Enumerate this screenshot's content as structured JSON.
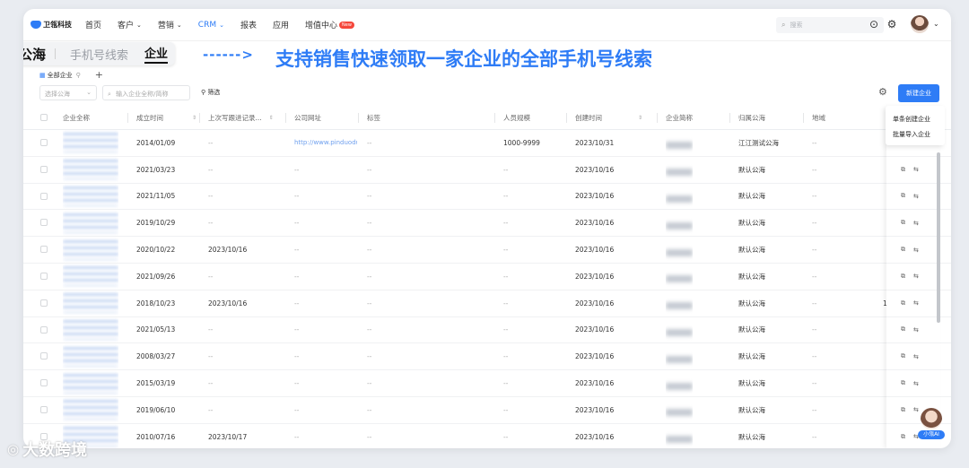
{
  "nav": {
    "logo_text": "卫瓴科技",
    "items": [
      {
        "label": "首页",
        "chevron": false
      },
      {
        "label": "客户",
        "chevron": true
      },
      {
        "label": "营销",
        "chevron": true
      },
      {
        "label": "CRM",
        "chevron": true,
        "active": true
      },
      {
        "label": "报表",
        "chevron": false
      },
      {
        "label": "应用",
        "chevron": false
      },
      {
        "label": "增值中心",
        "chevron": false,
        "badge": "New"
      }
    ],
    "search_placeholder": "搜索",
    "help_icon": "?",
    "settings_icon": "⚙"
  },
  "banner": {
    "tab_main": "公海",
    "tab_phone": "手机号线索",
    "tab_company": "企业",
    "arrow": "------>",
    "slogan": "支持销售快速领取一家企业的全部手机号线索"
  },
  "toolbar": {
    "view_label": "全部企业",
    "add_label": "+",
    "select_placeholder": "选择公海",
    "search_placeholder": "输入企业全称/简称",
    "filter_label": "筛选",
    "new_button": "新建企业",
    "dropdown": [
      "单条创建企业",
      "批量导入企业"
    ]
  },
  "table": {
    "headers": [
      "企业全称",
      "成立时间",
      "上次写跟进记录...",
      "公司网址",
      "标签",
      "人员规模",
      "创建时间",
      "企业简称",
      "归属公海",
      "地域"
    ],
    "rows": [
      {
        "founded": "2014/01/09",
        "followup": "--",
        "website": "http://www.pinduoduo.com",
        "tag": "--",
        "size": "1000-9999",
        "created": "2023/10/31",
        "pool": "江江测试公海",
        "region": "--",
        "extra": ""
      },
      {
        "founded": "2021/03/23",
        "followup": "--",
        "website": "--",
        "tag": "--",
        "size": "--",
        "created": "2023/10/16",
        "pool": "默认公海",
        "region": "--",
        "extra": ""
      },
      {
        "founded": "2021/11/05",
        "followup": "--",
        "website": "--",
        "tag": "--",
        "size": "--",
        "created": "2023/10/16",
        "pool": "默认公海",
        "region": "--",
        "extra": ""
      },
      {
        "founded": "2019/10/29",
        "followup": "--",
        "website": "--",
        "tag": "--",
        "size": "--",
        "created": "2023/10/16",
        "pool": "默认公海",
        "region": "--",
        "extra": ""
      },
      {
        "founded": "2020/10/22",
        "followup": "2023/10/16",
        "website": "--",
        "tag": "--",
        "size": "--",
        "created": "2023/10/16",
        "pool": "默认公海",
        "region": "--",
        "extra": ""
      },
      {
        "founded": "2021/09/26",
        "followup": "--",
        "website": "--",
        "tag": "--",
        "size": "--",
        "created": "2023/10/16",
        "pool": "默认公海",
        "region": "--",
        "extra": ""
      },
      {
        "founded": "2018/10/23",
        "followup": "2023/10/16",
        "website": "--",
        "tag": "--",
        "size": "--",
        "created": "2023/10/16",
        "pool": "默认公海",
        "region": "--",
        "extra": "1"
      },
      {
        "founded": "2021/05/13",
        "followup": "--",
        "website": "--",
        "tag": "--",
        "size": "--",
        "created": "2023/10/16",
        "pool": "默认公海",
        "region": "--",
        "extra": ""
      },
      {
        "founded": "2008/03/27",
        "followup": "--",
        "website": "--",
        "tag": "--",
        "size": "--",
        "created": "2023/10/16",
        "pool": "默认公海",
        "region": "--",
        "extra": ""
      },
      {
        "founded": "2015/03/19",
        "followup": "--",
        "website": "--",
        "tag": "--",
        "size": "--",
        "created": "2023/10/16",
        "pool": "默认公海",
        "region": "--",
        "extra": ""
      },
      {
        "founded": "2019/06/10",
        "followup": "--",
        "website": "--",
        "tag": "--",
        "size": "--",
        "created": "2023/10/16",
        "pool": "默认公海",
        "region": "--",
        "extra": ""
      },
      {
        "founded": "2010/07/16",
        "followup": "2023/10/17",
        "website": "--",
        "tag": "--",
        "size": "--",
        "created": "2023/10/16",
        "pool": "默认公海",
        "region": "--",
        "extra": ""
      }
    ]
  },
  "ai": {
    "label": "小瓴AI"
  },
  "watermark": "大数跨境"
}
